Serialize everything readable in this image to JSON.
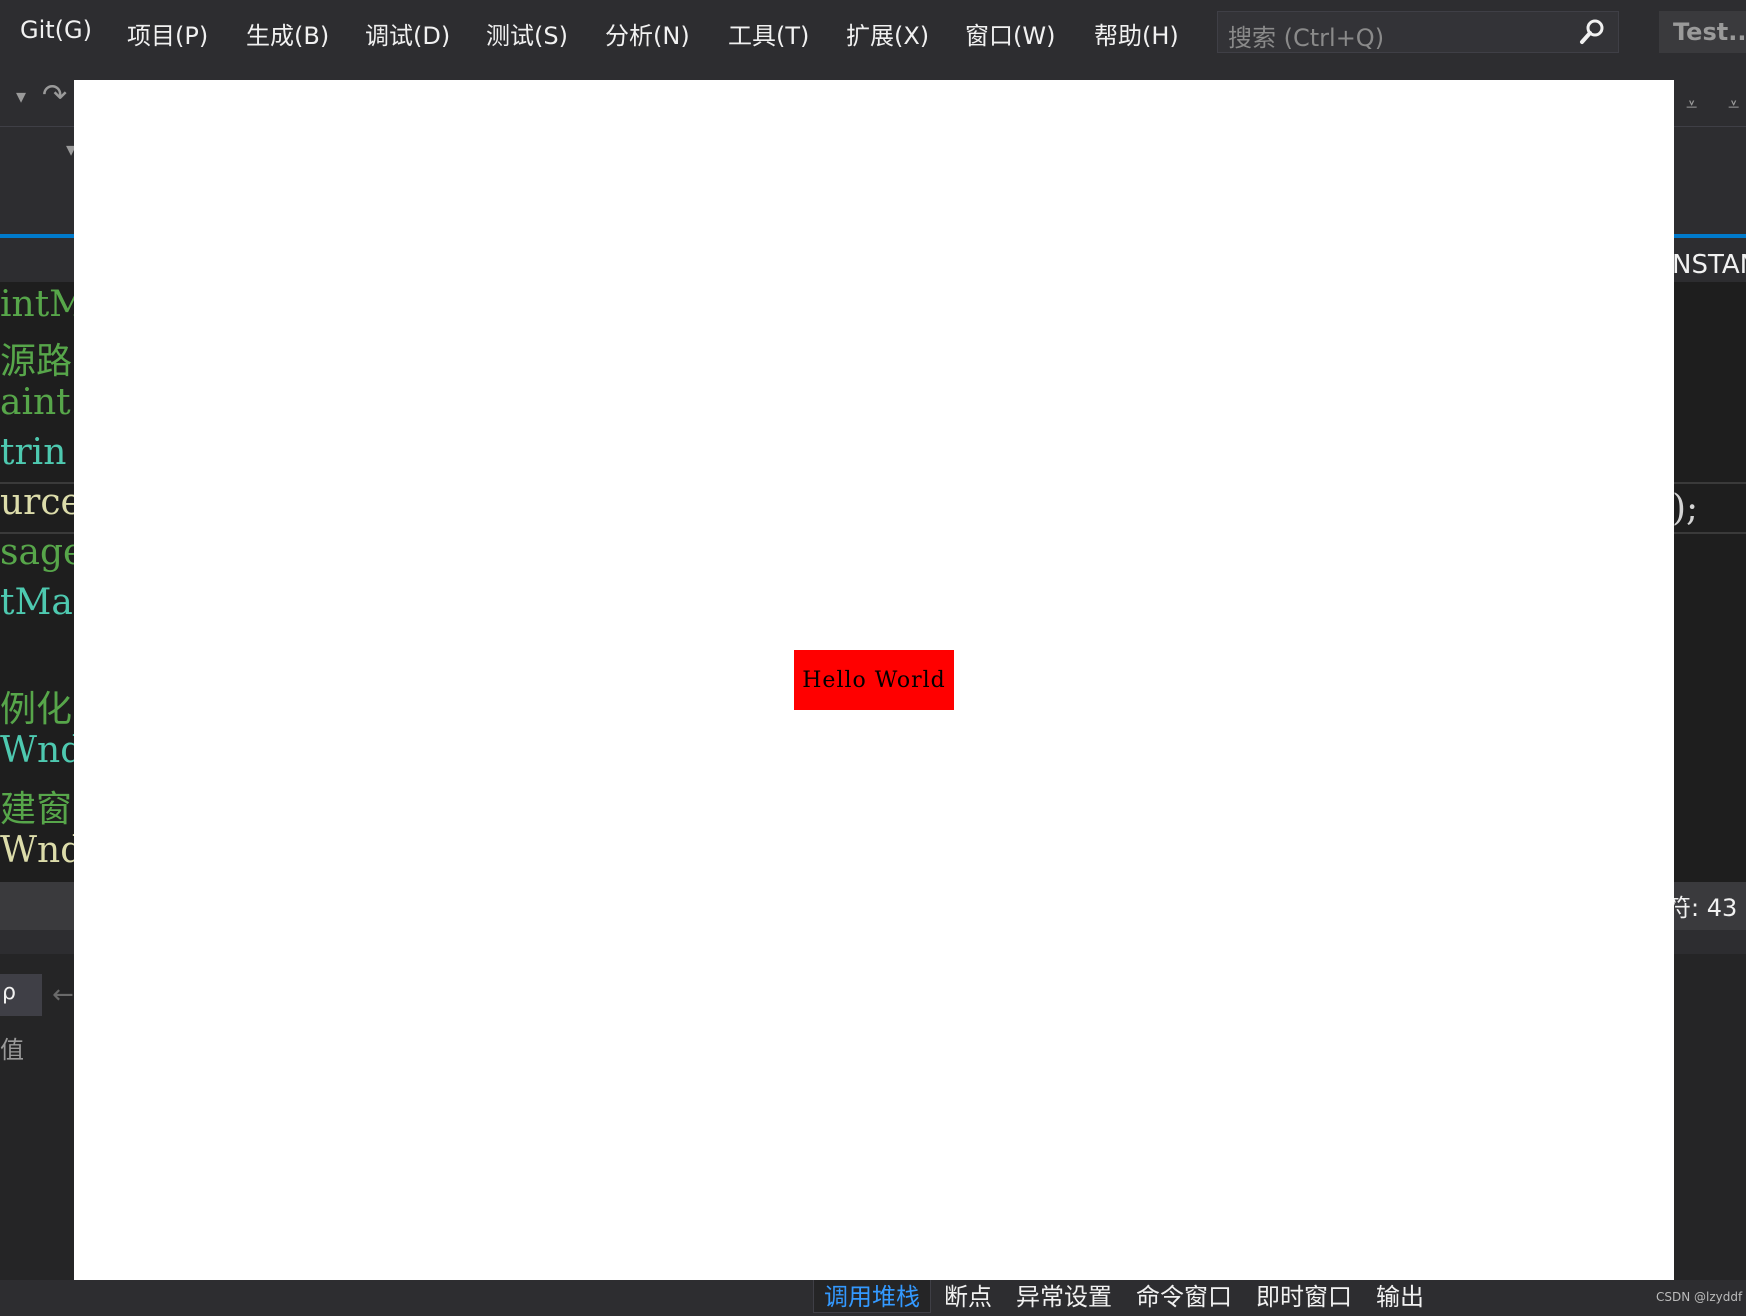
{
  "menu": [
    {
      "label": "Git(G)"
    },
    {
      "label": "项目(P)"
    },
    {
      "label": "生成(B)"
    },
    {
      "label": "调试(D)"
    },
    {
      "label": "测试(S)"
    },
    {
      "label": "分析(N)"
    },
    {
      "label": "工具(T)"
    },
    {
      "label": "扩展(X)"
    },
    {
      "label": "窗口(W)"
    },
    {
      "label": "帮助(H)"
    }
  ],
  "search": {
    "placeholder": "搜索 (Ctrl+Q)",
    "icon": "search-icon"
  },
  "window_title": "Test...",
  "tabstrip": {
    "right_text": "NSTAN"
  },
  "editor": {
    "lines": [
      {
        "text": "intM",
        "color": "#57a64a"
      },
      {
        "text": "源路",
        "color": "#57a64a"
      },
      {
        "text": "aint",
        "color": "#57a64a"
      },
      {
        "text": "trin",
        "color": "#4ec9b0"
      },
      {
        "text": "urce",
        "color": "#dcdcaa"
      },
      {
        "text": "sage",
        "color": "#57a64a"
      },
      {
        "text": "tMar",
        "color": "#4ec9b0"
      },
      {
        "text": "",
        "color": "#57a64a"
      },
      {
        "text": "例化",
        "color": "#57a64a"
      },
      {
        "text": "Wnd*",
        "color": "#4ec9b0"
      },
      {
        "text": "建窗",
        "color": "#57a64a"
      },
      {
        "text": "Wnd-",
        "color": "#dcdcaa"
      }
    ],
    "right_code": ");"
  },
  "status": {
    "position": "符: 43"
  },
  "panel": {
    "column_header": "值",
    "combo": "ρ"
  },
  "bottom_tabs": [
    {
      "label": "调用堆栈",
      "active": true
    },
    {
      "label": "断点",
      "active": false
    },
    {
      "label": "异常设置",
      "active": false
    },
    {
      "label": "命令窗口",
      "active": false
    },
    {
      "label": "即时窗口",
      "active": false
    },
    {
      "label": "输出",
      "active": false
    }
  ],
  "watermark": "CSDN @lzyddf",
  "app_window": {
    "button_text": "Hello World",
    "button_color": "#ff0000",
    "background": "#ffffff"
  }
}
